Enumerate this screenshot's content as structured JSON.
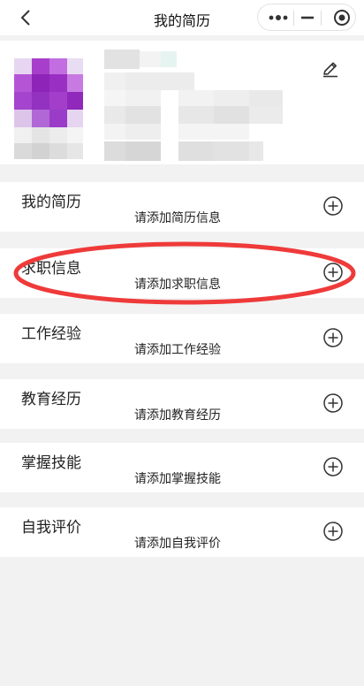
{
  "nav": {
    "title": "我的简历",
    "back_icon": "chevron-left-icon",
    "capsule_icons": [
      "more-dots-icon",
      "minimize-icon",
      "record-target-icon"
    ]
  },
  "profile": {
    "avatar_icon": "pixelated-avatar",
    "edit_icon": "pencil-icon"
  },
  "sections": [
    {
      "label": "我的简历",
      "hint": "请添加简历信息"
    },
    {
      "label": "求职信息",
      "hint": "请添加求职信息"
    },
    {
      "label": "工作经验",
      "hint": "请添加工作经验"
    },
    {
      "label": "教育经历",
      "hint": "请添加教育经历"
    },
    {
      "label": "掌握技能",
      "hint": "请添加掌握技能"
    },
    {
      "label": "自我评价",
      "hint": "请添加自我评价"
    }
  ],
  "colors": {
    "annotation_red": "#ef3a3a",
    "page_bg": "#f2f2f2",
    "avatar_purple": "#9b30c0"
  }
}
